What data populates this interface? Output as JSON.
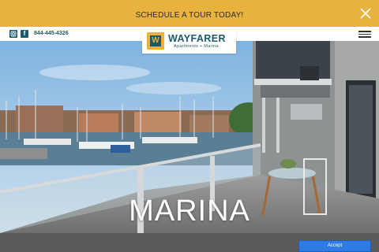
{
  "promo": {
    "text": "SCHEDULE A TOUR TODAY!",
    "close_icon": "close-icon",
    "background": "#e8b23e"
  },
  "nav": {
    "instagram_icon": "instagram-icon",
    "facebook_icon": "facebook-icon",
    "facebook_glyph": "f",
    "phone": "844-445-4326",
    "menu_icon": "hamburger-menu-icon"
  },
  "logo": {
    "mark": "W",
    "name": "WAYFARER",
    "subtitle": "Apartments + Marina",
    "brand_color": "#1c5a6b"
  },
  "hero": {
    "title": "MARINA"
  },
  "cookie": {
    "accept_label": "Accept",
    "button_color": "#2f7be4"
  }
}
